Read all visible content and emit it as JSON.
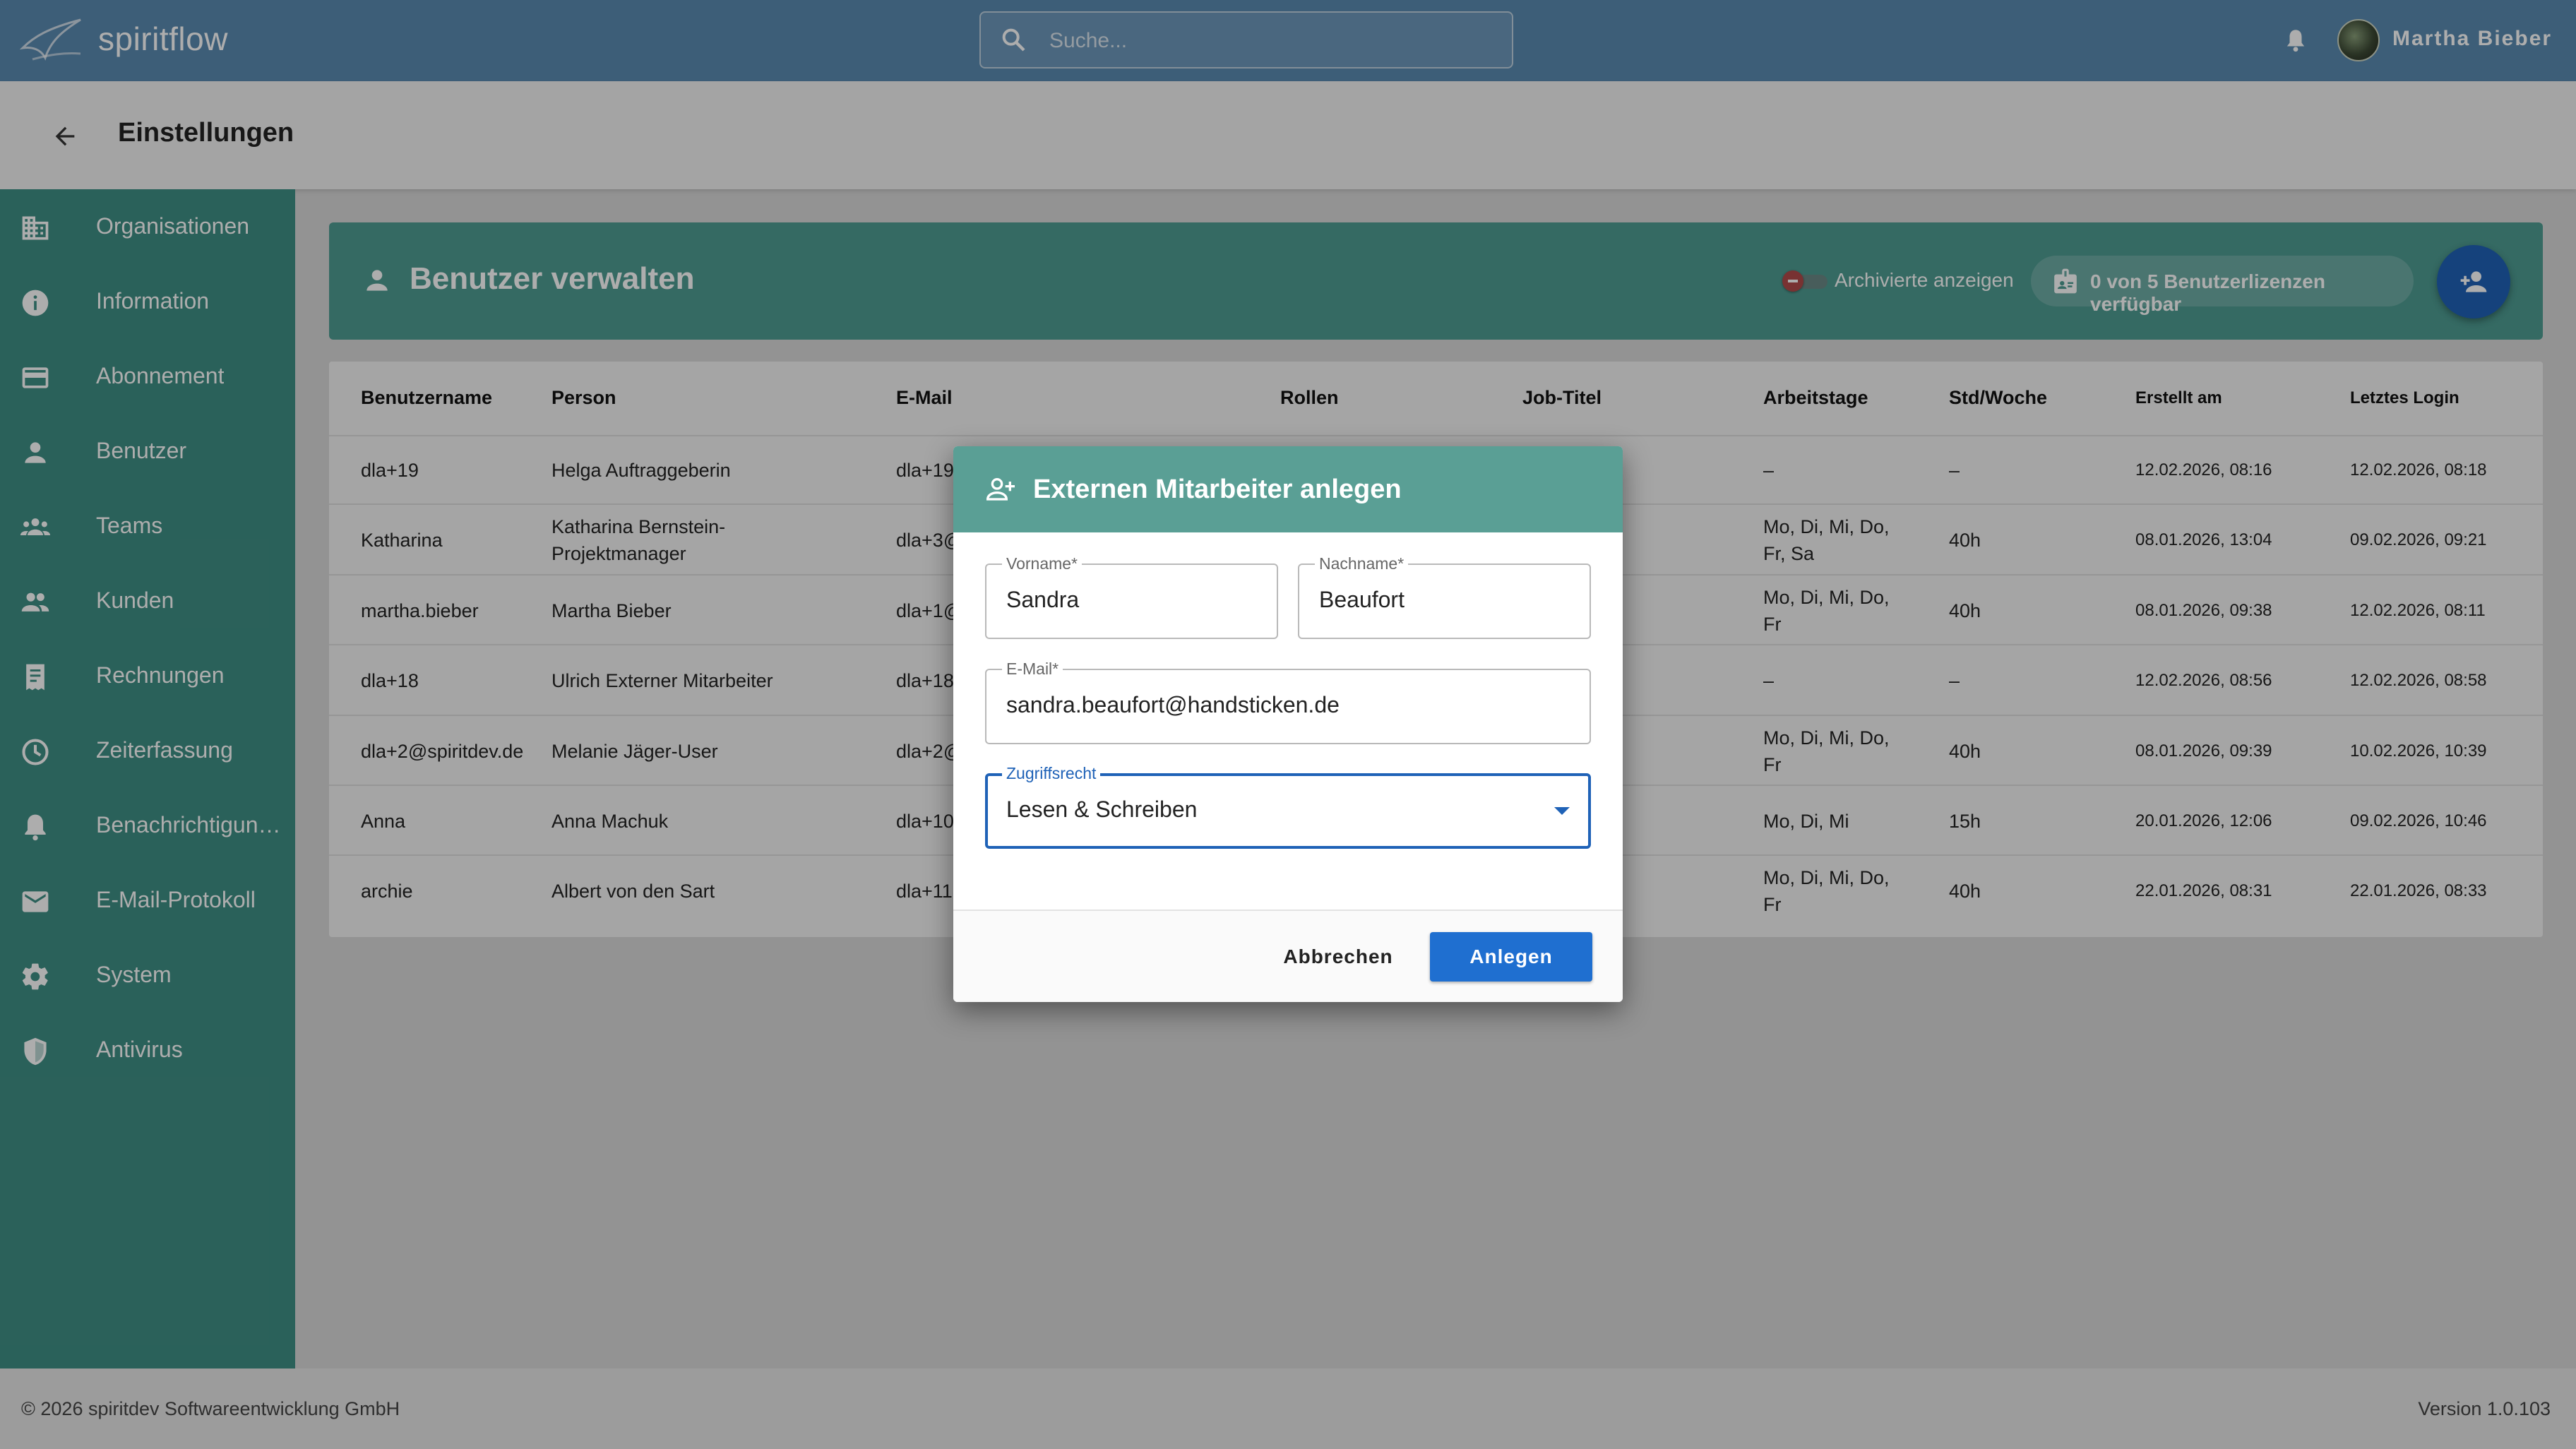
{
  "app": {
    "brand": "spiritflow",
    "search_placeholder": "Suche...",
    "user_name": "Martha Bieber"
  },
  "page": {
    "title": "Einstellungen"
  },
  "sidebar": {
    "items": [
      {
        "label": "Organisationen",
        "icon": "building-icon"
      },
      {
        "label": "Information",
        "icon": "info-icon"
      },
      {
        "label": "Abonnement",
        "icon": "credit-card-icon"
      },
      {
        "label": "Benutzer",
        "icon": "person-icon"
      },
      {
        "label": "Teams",
        "icon": "groups-icon"
      },
      {
        "label": "Kunden",
        "icon": "people-icon"
      },
      {
        "label": "Rechnungen",
        "icon": "receipt-icon"
      },
      {
        "label": "Zeiterfassung",
        "icon": "clock-icon"
      },
      {
        "label": "Benachrichtigungen",
        "icon": "bell-icon"
      },
      {
        "label": "E-Mail-Protokoll",
        "icon": "mail-icon"
      },
      {
        "label": "System",
        "icon": "gear-icon"
      },
      {
        "label": "Antivirus",
        "icon": "shield-icon"
      }
    ]
  },
  "users_panel": {
    "title": "Benutzer verwalten",
    "archived_toggle_label": "Archivierte anzeigen",
    "license_text": "0 von 5 Benutzerlizenzen verfügbar"
  },
  "table": {
    "headers": [
      "Benutzername",
      "Person",
      "E-Mail",
      "Rollen",
      "Job-Titel",
      "Arbeitstage",
      "Std/Woche",
      "Erstellt am",
      "Letztes Login"
    ],
    "rows": [
      {
        "username": "dla+19",
        "person": [
          "Helga Auftraggeberin",
          ""
        ],
        "email": "dla+19",
        "workdays": [
          "–",
          ""
        ],
        "hours": "–",
        "created": "12.02.2026, 08:16",
        "last_login": "12.02.2026, 08:18"
      },
      {
        "username": "Katharina",
        "person": [
          "Katharina Bernstein-",
          "Projektmanager"
        ],
        "email": "dla+3@",
        "workdays": [
          "Mo, Di, Mi, Do,",
          "Fr, Sa"
        ],
        "hours": "40h",
        "created": "08.01.2026, 13:04",
        "last_login": "09.02.2026, 09:21"
      },
      {
        "username": "martha.bieber",
        "person": [
          "Martha Bieber",
          ""
        ],
        "email": "dla+1@",
        "workdays": [
          "Mo, Di, Mi, Do,",
          "Fr"
        ],
        "hours": "40h",
        "created": "08.01.2026, 09:38",
        "last_login": "12.02.2026, 08:11"
      },
      {
        "username": "dla+18",
        "person": [
          "Ulrich Externer Mitarbeiter",
          ""
        ],
        "email": "dla+18",
        "workdays": [
          "–",
          ""
        ],
        "hours": "–",
        "created": "12.02.2026, 08:56",
        "last_login": "12.02.2026, 08:58"
      },
      {
        "username": "dla+2@spiritdev.de",
        "person": [
          "Melanie Jäger-User",
          ""
        ],
        "email": "dla+2@",
        "workdays": [
          "Mo, Di, Mi, Do,",
          "Fr"
        ],
        "hours": "40h",
        "created": "08.01.2026, 09:39",
        "last_login": "10.02.2026, 10:39"
      },
      {
        "username": "Anna",
        "person": [
          "Anna Machuk",
          ""
        ],
        "email": "dla+10",
        "workdays": [
          "Mo, Di, Mi",
          ""
        ],
        "hours": "15h",
        "created": "20.01.2026, 12:06",
        "last_login": "09.02.2026, 10:46"
      },
      {
        "username": "archie",
        "person": [
          "Albert von den Sart",
          ""
        ],
        "email": "dla+11",
        "workdays": [
          "Mo, Di, Mi, Do,",
          "Fr"
        ],
        "hours": "40h",
        "created": "22.01.2026, 08:31",
        "last_login": "22.01.2026, 08:33"
      }
    ]
  },
  "dialog": {
    "title": "Externen Mitarbeiter anlegen",
    "firstname_label": "Vorname*",
    "firstname_value": "Sandra",
    "lastname_label": "Nachname*",
    "lastname_value": "Beaufort",
    "email_label": "E-Mail*",
    "email_value": "sandra.beaufort@handsticken.de",
    "access_label": "Zugriffsrecht",
    "access_value": "Lesen & Schreiben",
    "cancel_label": "Abbrechen",
    "create_label": "Anlegen"
  },
  "footer": {
    "copyright": "© 2026 spiritdev Softwareentwicklung GmbH",
    "version": "Version 1.0.103"
  }
}
